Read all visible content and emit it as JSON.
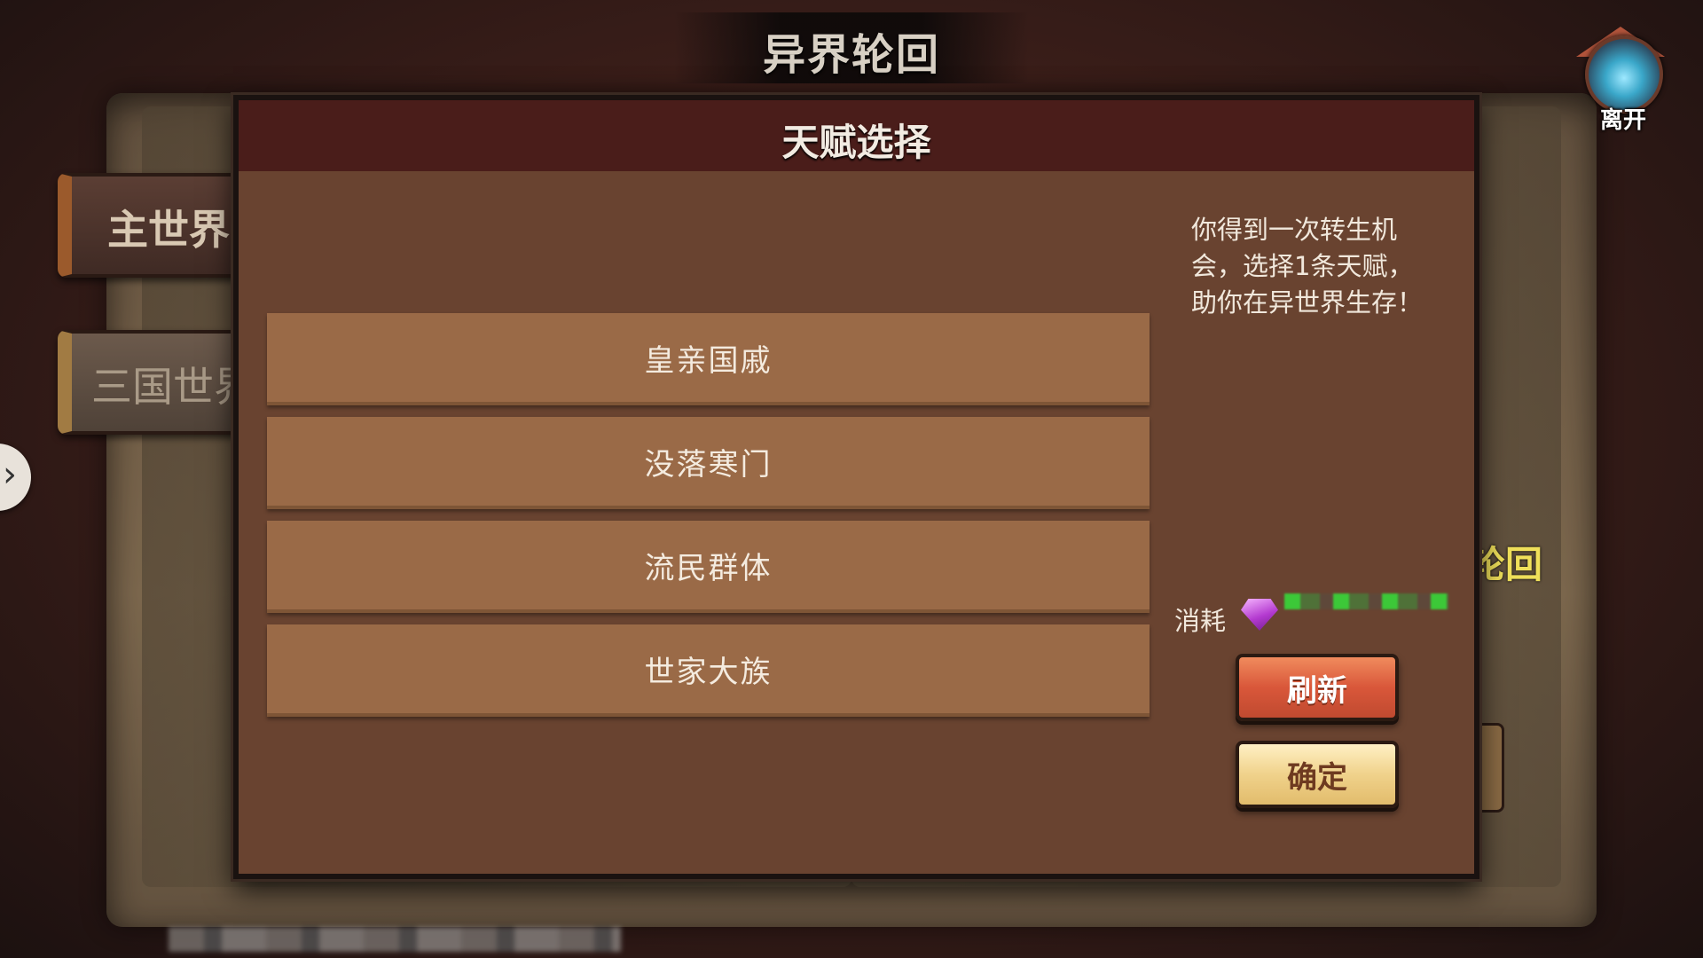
{
  "screen_title": "异界轮回",
  "leave_button": {
    "label": "离开",
    "icon": "portal-icon"
  },
  "side_tabs": [
    {
      "label": "主世界"
    },
    {
      "label": "三国世界"
    }
  ],
  "side_arrow": {
    "icon": "chevron-right-icon",
    "glyph": "›"
  },
  "background_peek_text": "轮回",
  "dialog": {
    "title": "天赋选择",
    "options": [
      {
        "label": "皇亲国戚"
      },
      {
        "label": "没落寒门"
      },
      {
        "label": "流民群体"
      },
      {
        "label": "世家大族"
      }
    ],
    "description": "你得到一次转生机会，选择1条天赋，助你在异世界生存！",
    "cost": {
      "label": "消耗",
      "icon": "gem-icon",
      "color": "#b43ad0"
    },
    "refresh_label": "刷新",
    "confirm_label": "确定"
  },
  "colors": {
    "dialog_bg": "#694330",
    "header_bg": "#4a1d1a",
    "option_bg": "#9a6a47",
    "refresh_btn": "#d9573a",
    "confirm_btn": "#f0d28b"
  }
}
